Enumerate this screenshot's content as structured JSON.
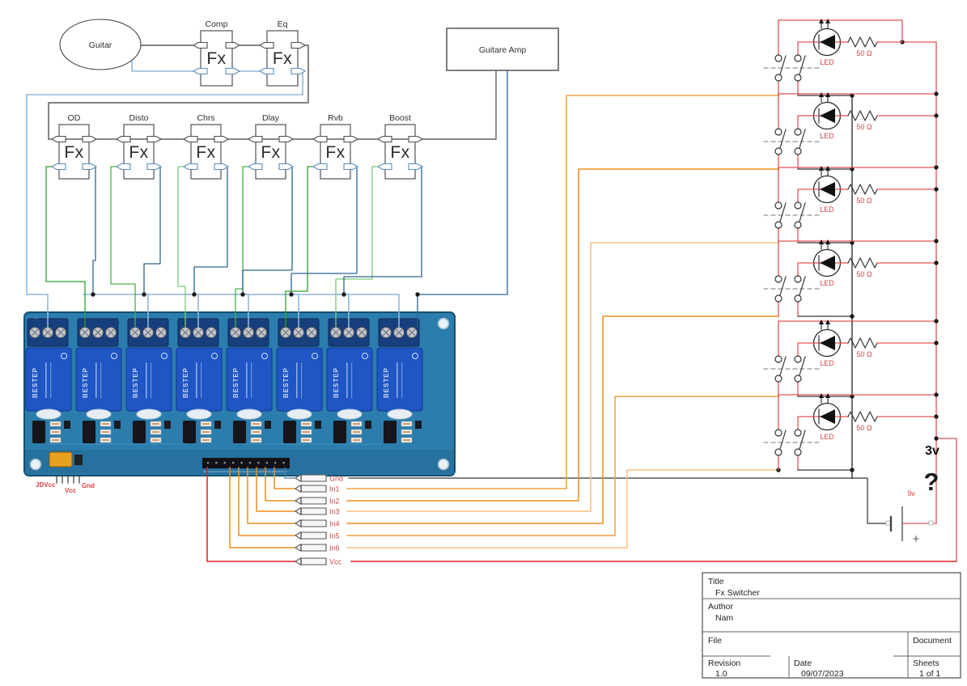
{
  "schematic": {
    "kind": "guitar-fx-switcher-circuit"
  },
  "guitar": {
    "label": "Guitar"
  },
  "amp": {
    "label": "Guitare Amp"
  },
  "fx_symbol": "Fx",
  "fx_boxes": [
    {
      "label": "Comp"
    },
    {
      "label": "Eq"
    },
    {
      "label": "OD"
    },
    {
      "label": "Disto"
    },
    {
      "label": "Chrs"
    },
    {
      "label": "Dlay"
    },
    {
      "label": "Rvb"
    },
    {
      "label": "Boost"
    }
  ],
  "relay_module": {
    "brand": "BESTEP",
    "jumper_label": "JDVcc",
    "vcc_label": "Vcc",
    "gnd_label": "Gnd"
  },
  "connectors": [
    {
      "label": "Gnd"
    },
    {
      "label": "In1"
    },
    {
      "label": "In2"
    },
    {
      "label": "In3"
    },
    {
      "label": "In4"
    },
    {
      "label": "In5"
    },
    {
      "label": "In6"
    },
    {
      "label": "Vcc"
    }
  ],
  "led_units": [
    {
      "led_label": "LED",
      "resistor_value": "50 Ω"
    },
    {
      "led_label": "LED",
      "resistor_value": "50 Ω"
    },
    {
      "led_label": "LED",
      "resistor_value": "50 Ω"
    },
    {
      "led_label": "LED",
      "resistor_value": "50 Ω"
    },
    {
      "led_label": "LED",
      "resistor_value": "50 Ω"
    },
    {
      "led_label": "LED",
      "resistor_value": "50 Ω"
    }
  ],
  "battery": {
    "voltage_label": "9v",
    "plus_label": "+"
  },
  "annotations": {
    "supply_voltage": "3v",
    "question_mark": "?"
  },
  "title_block": {
    "title_label": "Title",
    "title": "Fx Switcher",
    "author_label": "Author",
    "author": "Nam",
    "file_label": "File",
    "document_label": "Document",
    "revision_label": "Revision",
    "revision": "1.0",
    "date_label": "Date",
    "date": "09/07/2023",
    "sheets_label": "Sheets",
    "sheets": "1 of 1"
  },
  "colors": {
    "wire_signal": "#35353a",
    "wire_return_bus": "#93b7d6",
    "wire_fx_send": "#3aa03a",
    "wire_fx_return": "#2d6590",
    "wire_inputs": "#ee8e1a",
    "wire_led": "#e25353",
    "wire_vcc": "#e01f1f",
    "pcb_blue": "#2b7dad",
    "relay_blue": "#1f55c4",
    "terminal_navy": "#173f7e",
    "label_red": "#c84848"
  }
}
